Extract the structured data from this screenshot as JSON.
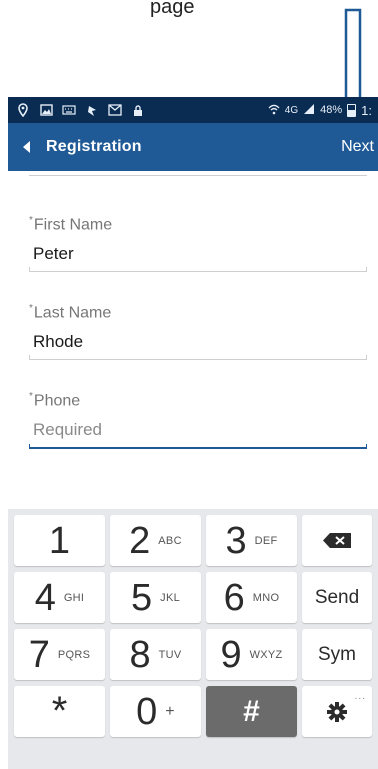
{
  "caption": "page",
  "status_bar": {
    "battery": "48%",
    "time": "1:",
    "network": "4G"
  },
  "app_bar": {
    "title": "Registration",
    "next_label": "Next"
  },
  "form": {
    "fields": [
      {
        "required_mark": "*",
        "label": "First Name",
        "value": "Peter",
        "placeholder": ""
      },
      {
        "required_mark": "*",
        "label": "Last Name",
        "value": "Rhode",
        "placeholder": ""
      },
      {
        "required_mark": "*",
        "label": "Phone",
        "value": "",
        "placeholder": "Required"
      }
    ]
  },
  "keyboard": {
    "rows": [
      [
        {
          "digit": "1",
          "sub": ""
        },
        {
          "digit": "2",
          "sub": "ABC"
        },
        {
          "digit": "3",
          "sub": "DEF"
        }
      ],
      [
        {
          "digit": "4",
          "sub": "GHI"
        },
        {
          "digit": "5",
          "sub": "JKL"
        },
        {
          "digit": "6",
          "sub": "MNO"
        }
      ],
      [
        {
          "digit": "7",
          "sub": "PQRS"
        },
        {
          "digit": "8",
          "sub": "TUV"
        },
        {
          "digit": "9",
          "sub": "WXYZ"
        }
      ],
      [
        {
          "digit": "*",
          "sub": ""
        },
        {
          "digit": "0",
          "sub": "+"
        },
        {
          "digit": "#",
          "sub": ""
        }
      ]
    ],
    "send_label": "Send",
    "sym_label": "Sym",
    "settings_dots": "..."
  },
  "colors": {
    "status_bar_bg": "#0a2c52",
    "app_bar_bg": "#1f5a96",
    "keyboard_bg": "#e7e8ec",
    "arrow": "#1f5a96"
  }
}
